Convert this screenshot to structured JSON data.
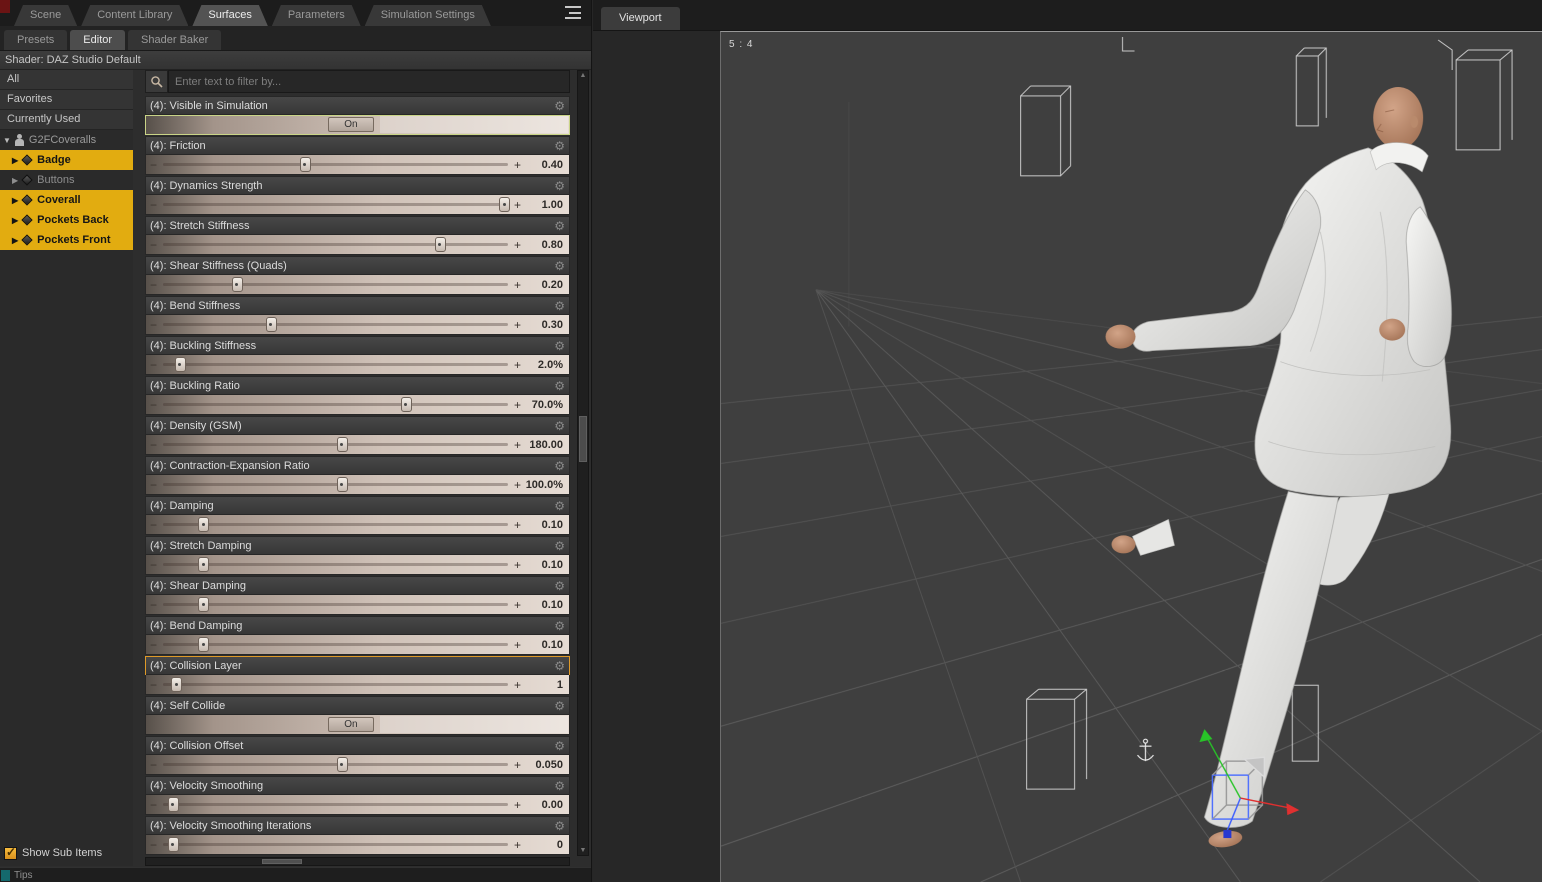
{
  "colors": {
    "selection_yellow": "#e2ac10",
    "highlight_orange": "#df9a28",
    "focus_green": "#c9d487",
    "corner_red": "#6b1414",
    "gizmo_red": "#e03030",
    "gizmo_green": "#28c428",
    "gizmo_blue": "#3a5cff"
  },
  "main_tabs": [
    {
      "label": "Scene",
      "active": false
    },
    {
      "label": "Content Library",
      "active": false
    },
    {
      "label": "Surfaces",
      "active": true
    },
    {
      "label": "Parameters",
      "active": false
    },
    {
      "label": "Simulation Settings",
      "active": false
    }
  ],
  "sub_tabs": [
    {
      "label": "Presets",
      "active": false
    },
    {
      "label": "Editor",
      "active": true
    },
    {
      "label": "Shader Baker",
      "active": false
    }
  ],
  "shader_label": "Shader: DAZ Studio Default",
  "sidebar": {
    "filters": [
      "All",
      "Favorites",
      "Currently Used"
    ],
    "tree_root": "G2FCoveralls",
    "tree_items": [
      {
        "label": "Badge",
        "selected": true
      },
      {
        "label": "Buttons",
        "selected": false
      },
      {
        "label": "Coverall",
        "selected": true
      },
      {
        "label": "Pockets Back",
        "selected": true
      },
      {
        "label": "Pockets Front",
        "selected": true
      }
    ]
  },
  "search_placeholder": "Enter text to filter by...",
  "parameters": [
    {
      "label": "(4): Visible in Simulation",
      "type": "toggle",
      "value": "On",
      "highlight": "green"
    },
    {
      "label": "(4): Friction",
      "type": "slider",
      "value": "0.40",
      "frac": 0.41
    },
    {
      "label": "(4): Dynamics Strength",
      "type": "slider",
      "value": "1.00",
      "frac": 1.0
    },
    {
      "label": "(4): Stretch Stiffness",
      "type": "slider",
      "value": "0.80",
      "frac": 0.81
    },
    {
      "label": "(4): Shear Stiffness (Quads)",
      "type": "slider",
      "value": "0.20",
      "frac": 0.21
    },
    {
      "label": "(4): Bend Stiffness",
      "type": "slider",
      "value": "0.30",
      "frac": 0.31
    },
    {
      "label": "(4): Buckling Stiffness",
      "type": "slider",
      "value": "2.0%",
      "frac": 0.04
    },
    {
      "label": "(4): Buckling Ratio",
      "type": "slider",
      "value": "70.0%",
      "frac": 0.71
    },
    {
      "label": "(4): Density (GSM)",
      "type": "slider",
      "value": "180.00",
      "frac": 0.52
    },
    {
      "label": "(4): Contraction-Expansion Ratio",
      "type": "slider",
      "value": "100.0%",
      "frac": 0.52
    },
    {
      "label": "(4): Damping",
      "type": "slider",
      "value": "0.10",
      "frac": 0.11
    },
    {
      "label": "(4): Stretch Damping",
      "type": "slider",
      "value": "0.10",
      "frac": 0.11
    },
    {
      "label": "(4): Shear Damping",
      "type": "slider",
      "value": "0.10",
      "frac": 0.11
    },
    {
      "label": "(4): Bend Damping",
      "type": "slider",
      "value": "0.10",
      "frac": 0.11
    },
    {
      "label": "(4): Collision Layer",
      "type": "slider",
      "value": "1",
      "frac": 0.03,
      "highlight": "orange"
    },
    {
      "label": "(4): Self Collide",
      "type": "toggle",
      "value": "On"
    },
    {
      "label": "(4): Collision Offset",
      "type": "slider",
      "value": "0.050",
      "frac": 0.52
    },
    {
      "label": "(4): Velocity Smoothing",
      "type": "slider",
      "value": "0.00",
      "frac": 0.02
    },
    {
      "label": "(4): Velocity Smoothing Iterations",
      "type": "slider",
      "value": "0",
      "frac": 0.02
    }
  ],
  "controls": {
    "decrement": "−",
    "increment": "+",
    "gear": "⚙",
    "collapsed_arrow": "▶",
    "expanded_arrow": "▼",
    "check": "✓"
  },
  "footer": {
    "show_sub_items": "Show Sub Items",
    "tips": "Tips"
  },
  "viewport": {
    "tab": "Viewport",
    "aspect": "5 : 4"
  }
}
